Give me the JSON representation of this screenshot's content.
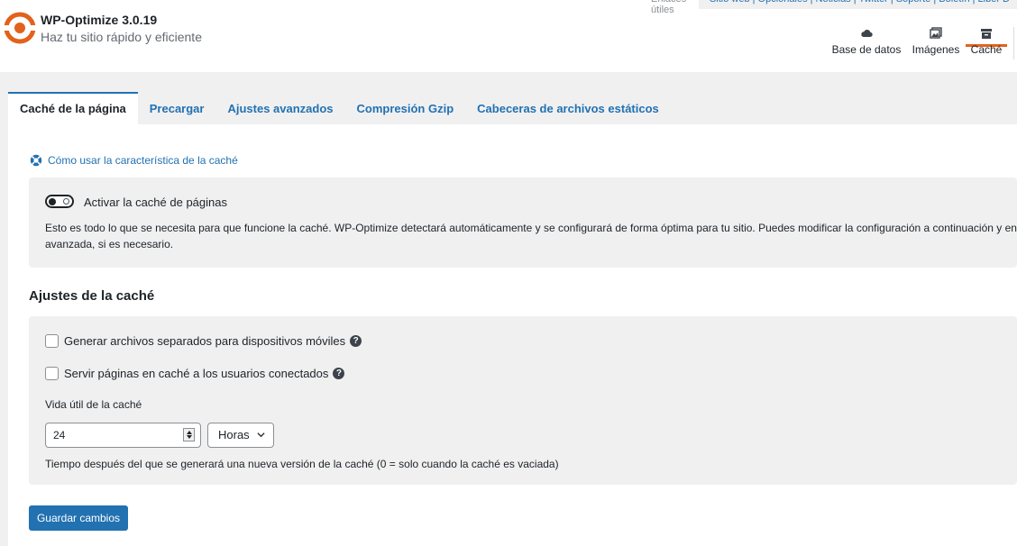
{
  "header": {
    "title": "WP-Optimize 3.0.19",
    "subtitle": "Haz tu sitio rápido y eficiente",
    "util_label": "Enlaces útiles",
    "util_links": "Sitio web | Opcionales | Noticias | Twitter | Soporte | Boletín | Liber D"
  },
  "modules": [
    {
      "label": "Base de datos",
      "icon": "cloud-icon"
    },
    {
      "label": "Imágenes",
      "icon": "images-icon"
    },
    {
      "label": "Caché",
      "icon": "archive-icon",
      "active": true
    }
  ],
  "tabs": [
    {
      "label": "Caché de la página",
      "active": true
    },
    {
      "label": "Precargar"
    },
    {
      "label": "Ajustes avanzados"
    },
    {
      "label": "Compresión Gzip"
    },
    {
      "label": "Cabeceras de archivos estáticos"
    }
  ],
  "help_link": "Cómo usar la característica de la caché",
  "enable_cache": {
    "label": "Activar la caché de páginas",
    "enabled": false,
    "description": "Esto es todo lo que se necesita para que funcione la caché. WP-Optimize detectará automáticamente y se configurará de forma óptima para tu sitio. Puedes modificar la configuración a continuación y en avanzada, si es necesario."
  },
  "settings": {
    "title": "Ajustes de la caché",
    "mobile_label": "Generar archivos separados para dispositivos móviles",
    "logged_in_label": "Servir páginas en caché a los usuarios conectados",
    "lifespan_label": "Vida útil de la caché",
    "lifespan_value": "24",
    "lifespan_unit": "Horas",
    "hint": "Tiempo después del que se generará una nueva versión de la caché (0 = solo cuando la caché es vaciada)"
  },
  "save_label": "Guardar cambios",
  "colors": {
    "accent": "#2271b1",
    "brand": "#e2621b"
  }
}
